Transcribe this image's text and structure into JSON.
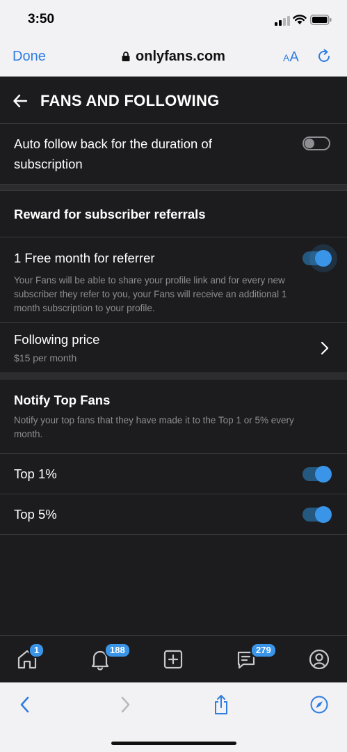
{
  "status_bar": {
    "time": "3:50"
  },
  "safari": {
    "done_label": "Done",
    "url": "onlyfans.com",
    "aa_small": "A",
    "aa_large": "A"
  },
  "header": {
    "title": "FANS AND FOLLOWING"
  },
  "settings": {
    "auto_follow": {
      "label_line1": "Auto follow back for the duration of",
      "label_line2": "subscription",
      "enabled": false
    },
    "referrals_section_title": "Reward for subscriber referrals",
    "free_month": {
      "label": "1 Free month for referrer",
      "desc_line1": "Your Fans will be able to share your profile link and for every new",
      "desc_line2": "subscriber they refer to you, your Fans will receive an additional 1",
      "desc_line3": "month subscription to your profile.",
      "enabled": true
    },
    "following_price": {
      "label": "Following price",
      "value": "$15 per month"
    },
    "notify_top_fans": {
      "title": "Notify Top Fans",
      "desc_line1": "Notify your top fans that they have made it to the Top 1 or 5% every",
      "desc_line2": "month."
    },
    "top1": {
      "label": "Top 1%",
      "enabled": true
    },
    "top5": {
      "label": "Top 5%",
      "enabled": true
    }
  },
  "bottom_nav": {
    "home_badge": "1",
    "notifications_badge": "188",
    "messages_badge": "279",
    "icons": [
      "home-icon",
      "bell-icon",
      "plus-square-icon",
      "messages-icon",
      "profile-icon"
    ]
  },
  "colors": {
    "accent": "#3a95e8",
    "background": "#1c1c1e",
    "ios_blue": "#2f7de1"
  }
}
